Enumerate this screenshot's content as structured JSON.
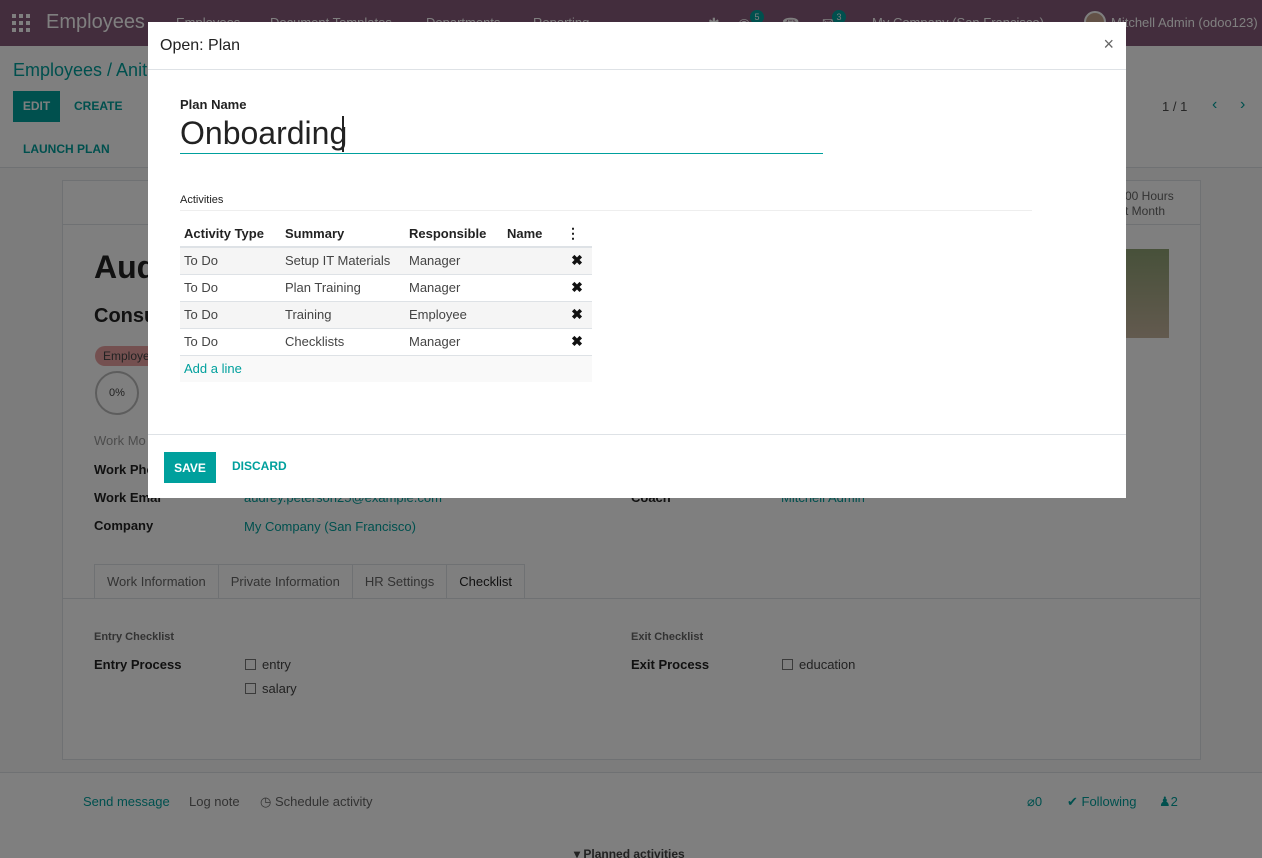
{
  "navbar": {
    "app_title": "Employees",
    "menus": [
      "Employees",
      "Document Templates",
      "Departments",
      "Reporting"
    ],
    "activity_badge": "5",
    "chat_badge": "3",
    "company": "My Company (San Francisco)",
    "user": "Mitchell Admin (odoo123)"
  },
  "control_panel": {
    "breadcrumb": "Employees / Anit",
    "edit_label": "EDIT",
    "create_label": "CREATE",
    "pager": "1 / 1",
    "launch_plan_label": "LAUNCH PLAN"
  },
  "employee": {
    "stat_line1": "00 Hours",
    "stat_line2": "t Month",
    "name_partial": "Aud",
    "job_partial": "Consu",
    "tag_partial": "Employe",
    "progress": "0%",
    "work_mobile_label": "Work Mo",
    "work_phone_label": "Work Pho",
    "work_email_label": "Work Emai",
    "work_email_value": "audrey.peterson25@example.com",
    "company_label": "Company",
    "company_value": "My Company (San Francisco)",
    "coach_label": "Coach",
    "coach_value": "Mitchell Admin"
  },
  "tabs": [
    "Work Information",
    "Private Information",
    "HR Settings",
    "Checklist"
  ],
  "checklist": {
    "entry_title": "Entry Checklist",
    "entry_label": "Entry Process",
    "entry_items": [
      "entry",
      "salary"
    ],
    "exit_title": "Exit Checklist",
    "exit_label": "Exit Process",
    "exit_items": [
      "education"
    ]
  },
  "chatter": {
    "send_message": "Send message",
    "log_note": "Log note",
    "schedule_activity": "Schedule activity",
    "attachments": "0",
    "following": "Following",
    "followers": "2",
    "planned_activities": "Planned activities"
  },
  "modal": {
    "title": "Open: Plan",
    "close_icon": "close-icon",
    "plan_name_label": "Plan Name",
    "plan_name_value": "Onboarding",
    "activities_label": "Activities",
    "columns": [
      "Activity Type",
      "Summary",
      "Responsible",
      "Name"
    ],
    "rows": [
      {
        "type": "To Do",
        "summary": "Setup IT Materials",
        "responsible": "Manager",
        "name": ""
      },
      {
        "type": "To Do",
        "summary": "Plan Training",
        "responsible": "Manager",
        "name": ""
      },
      {
        "type": "To Do",
        "summary": "Training",
        "responsible": "Employee",
        "name": ""
      },
      {
        "type": "To Do",
        "summary": "Checklists",
        "responsible": "Manager",
        "name": ""
      }
    ],
    "add_line": "Add a line",
    "save_label": "SAVE",
    "discard_label": "DISCARD"
  }
}
